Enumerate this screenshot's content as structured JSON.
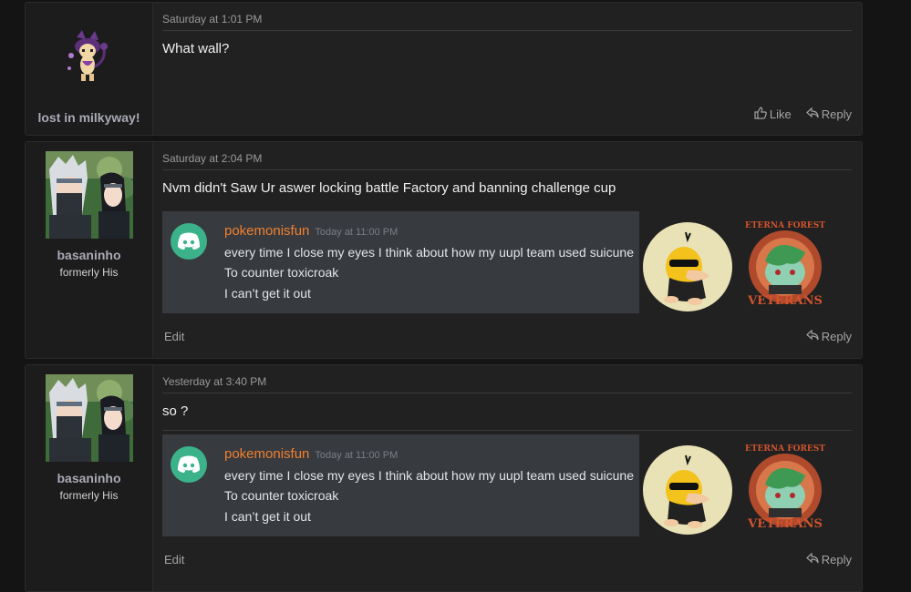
{
  "posts": [
    {
      "timestamp": "Saturday at 1:01 PM",
      "message": "What wall?",
      "user": {
        "name": "lost in milkyway!"
      },
      "actions": {
        "like": "Like",
        "reply": "Reply"
      }
    },
    {
      "timestamp": "Saturday at 2:04 PM",
      "message": "Nvm didn't Saw Ur aswer locking battle Factory and banning challenge cup",
      "user": {
        "name": "basaninho",
        "title": "formerly His"
      },
      "embed": {
        "author": "pokemonisfun",
        "time": "Today at 11:00 PM",
        "lines": [
          "every time I close my eyes I think about how my uupl team used suicune",
          "To counter toxicroak",
          "I can’t get it out"
        ],
        "badge_text_top": "ETERNA FOREST",
        "badge_text_bottom": "VETERANS"
      },
      "actions": {
        "edit": "Edit",
        "reply": "Reply"
      }
    },
    {
      "timestamp": "Yesterday at 3:40 PM",
      "message": "so ?",
      "user": {
        "name": "basaninho",
        "title": "formerly His"
      },
      "embed": {
        "author": "pokemonisfun",
        "time": "Today at 11:00 PM",
        "lines": [
          "every time I close my eyes I think about how my uupl team used suicune",
          "To counter toxicroak",
          "I can’t get it out"
        ],
        "badge_text_top": "ETERNA FOREST",
        "badge_text_bottom": "VETERANS"
      },
      "actions": {
        "edit": "Edit",
        "reply": "Reply"
      }
    }
  ],
  "colors": {
    "accent_orange": "#f0802f",
    "discord_green": "#3bb28a",
    "username_color": "#a9aab6"
  },
  "icons": [
    "thumbs-up-icon",
    "reply-icon",
    "discord-icon"
  ]
}
